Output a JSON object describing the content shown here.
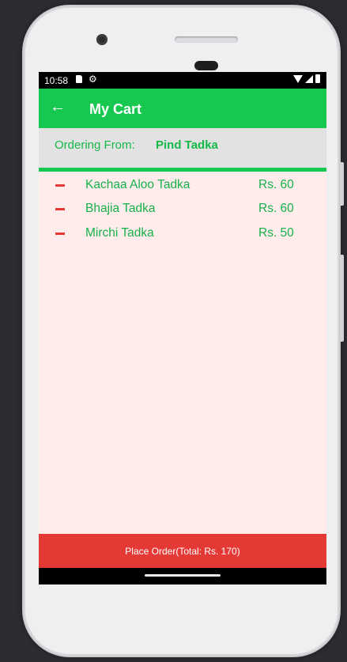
{
  "status_bar": {
    "time": "10:58",
    "icons": [
      "sd-card-icon",
      "settings-icon",
      "wifi-icon",
      "cell-signal-icon",
      "battery-icon"
    ]
  },
  "app_bar": {
    "back_icon": "arrow-left-icon",
    "title": "My Cart"
  },
  "ordering_from": {
    "label": "Ordering From:",
    "restaurant": "Pind Tadka"
  },
  "cart_items": [
    {
      "name": "Kachaa Aloo Tadka",
      "price": "Rs. 60",
      "remove_icon": "minus-icon"
    },
    {
      "name": "Bhajia Tadka",
      "price": "Rs. 60",
      "remove_icon": "minus-icon"
    },
    {
      "name": "Mirchi Tadka",
      "price": "Rs. 50",
      "remove_icon": "minus-icon"
    }
  ],
  "place_order_label": "Place Order(Total: Rs. 170)",
  "colors": {
    "primary_green": "#16c84f",
    "accent_red": "#e53935",
    "cart_background": "#ffeceb",
    "from_bar_background": "#e2e2e2"
  }
}
